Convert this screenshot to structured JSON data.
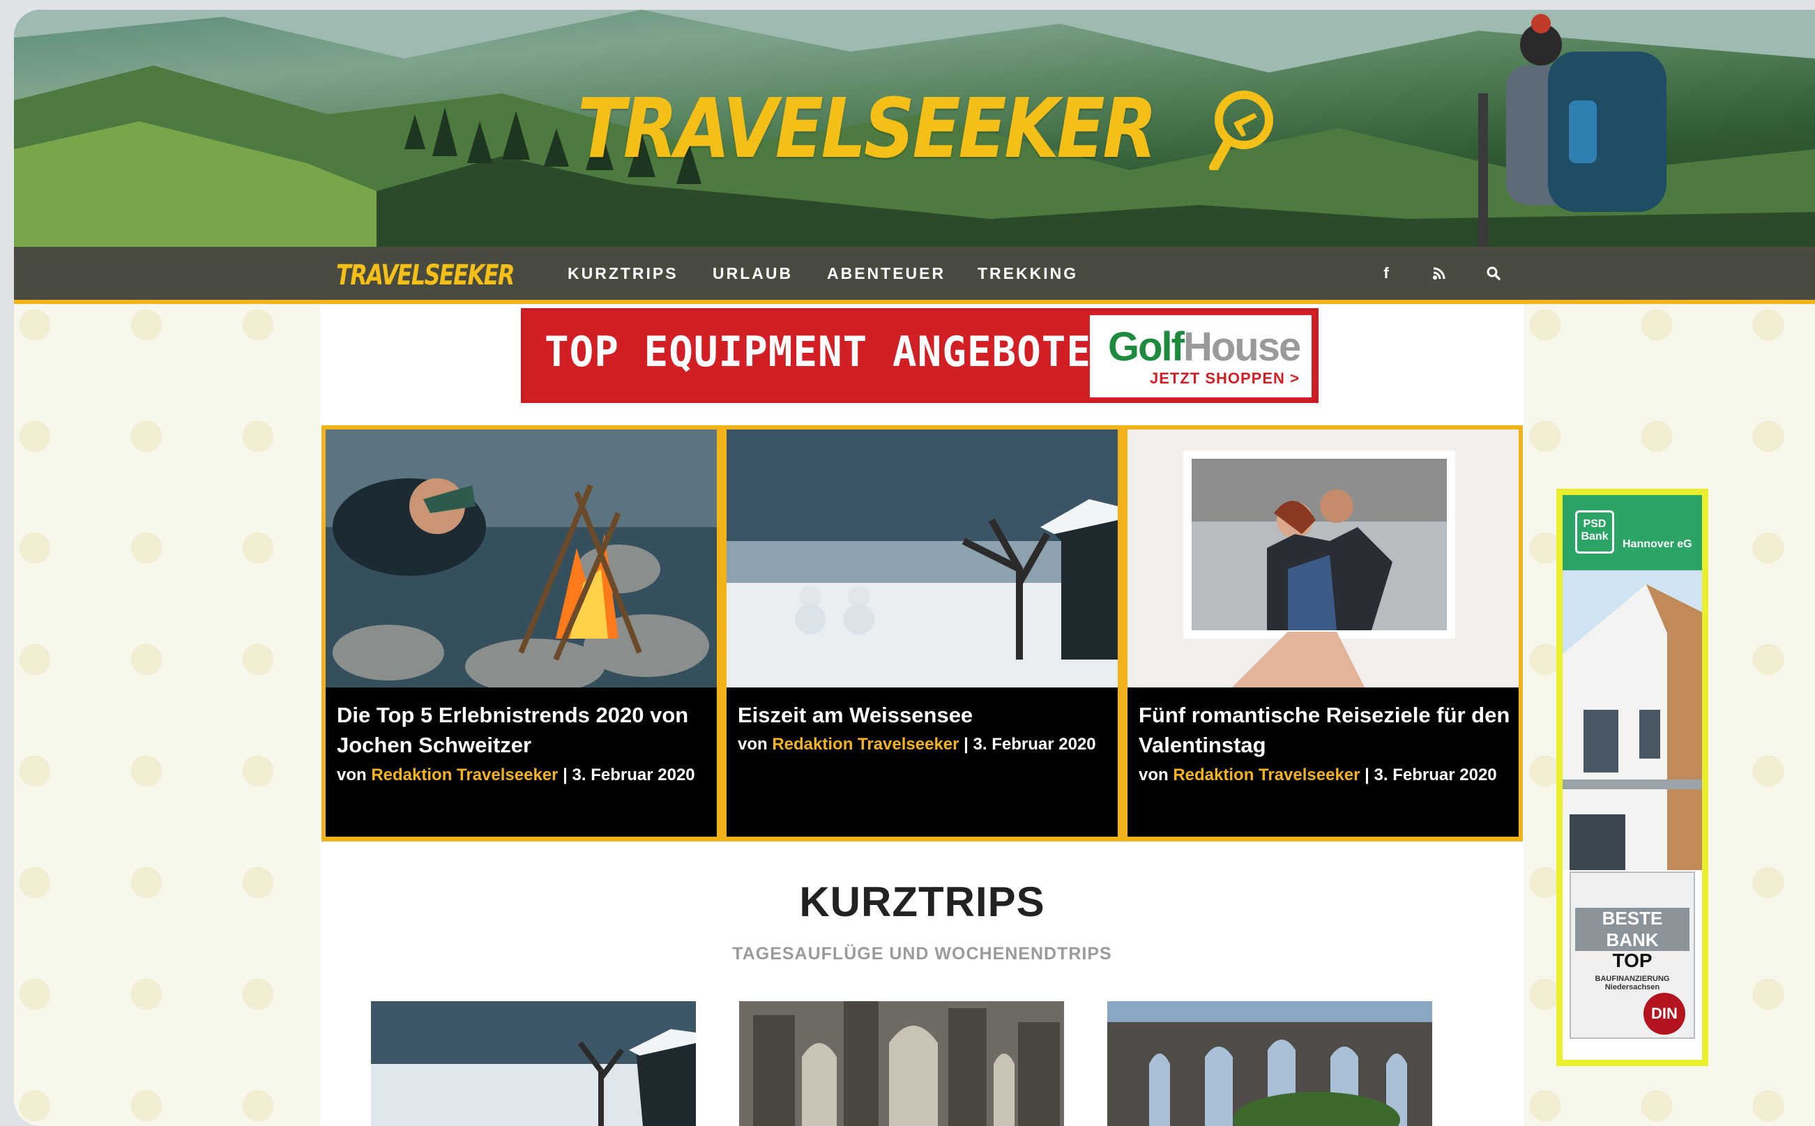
{
  "site": {
    "logo_text": "TRAVELSEEKER",
    "nav_logo_text": "TRAVELSEEKER"
  },
  "nav": {
    "items": [
      {
        "label": "KURZTRIPS"
      },
      {
        "label": "URLAUB"
      },
      {
        "label": "ABENTEUER"
      },
      {
        "label": "TREKKING"
      }
    ],
    "icons": [
      "facebook-icon",
      "rss-icon",
      "search-icon"
    ],
    "icon_glyphs": {
      "facebook": "f",
      "rss": "⌁",
      "search": "⌕"
    }
  },
  "banner": {
    "text": "TOP EQUIPMENT ANGEBOTE",
    "brand_golf": "Golf",
    "brand_house": "House",
    "cta": "JETZT SHOPPEN >"
  },
  "featured": [
    {
      "title": "Die Top 5 Erlebnistrends 2020 von Jochen Schweitzer",
      "by_prefix": "von ",
      "author": "Redaktion Travelseeker",
      "date": " | 3. Februar 2020"
    },
    {
      "title": "Eiszeit am Weissensee",
      "by_prefix": "von ",
      "author": "Redaktion Travelseeker",
      "date": " | 3. Februar 2020"
    },
    {
      "title": "Fünf romantische Reiseziele für den Valentinstag",
      "by_prefix": "von ",
      "author": "Redaktion Travelseeker",
      "date": " | 3. Februar 2020"
    }
  ],
  "section": {
    "title": "KURZTRIPS",
    "subtitle": "TAGESAUFLÜGE UND WOCHENENDTRIPS"
  },
  "side_ad": {
    "bank_logo": "PSD Bank",
    "bank_name": "Hannover eG",
    "award_line1": "BESTE BANK",
    "award_line2": "TOP",
    "award_line3": "BAUFINANZIERUNG Niedersachsen",
    "seal": "DIN"
  },
  "colors": {
    "accent": "#f4b21b",
    "banner_red": "#d21f26",
    "golf_green": "#1e8a3d",
    "bank_green": "#2aa566"
  }
}
